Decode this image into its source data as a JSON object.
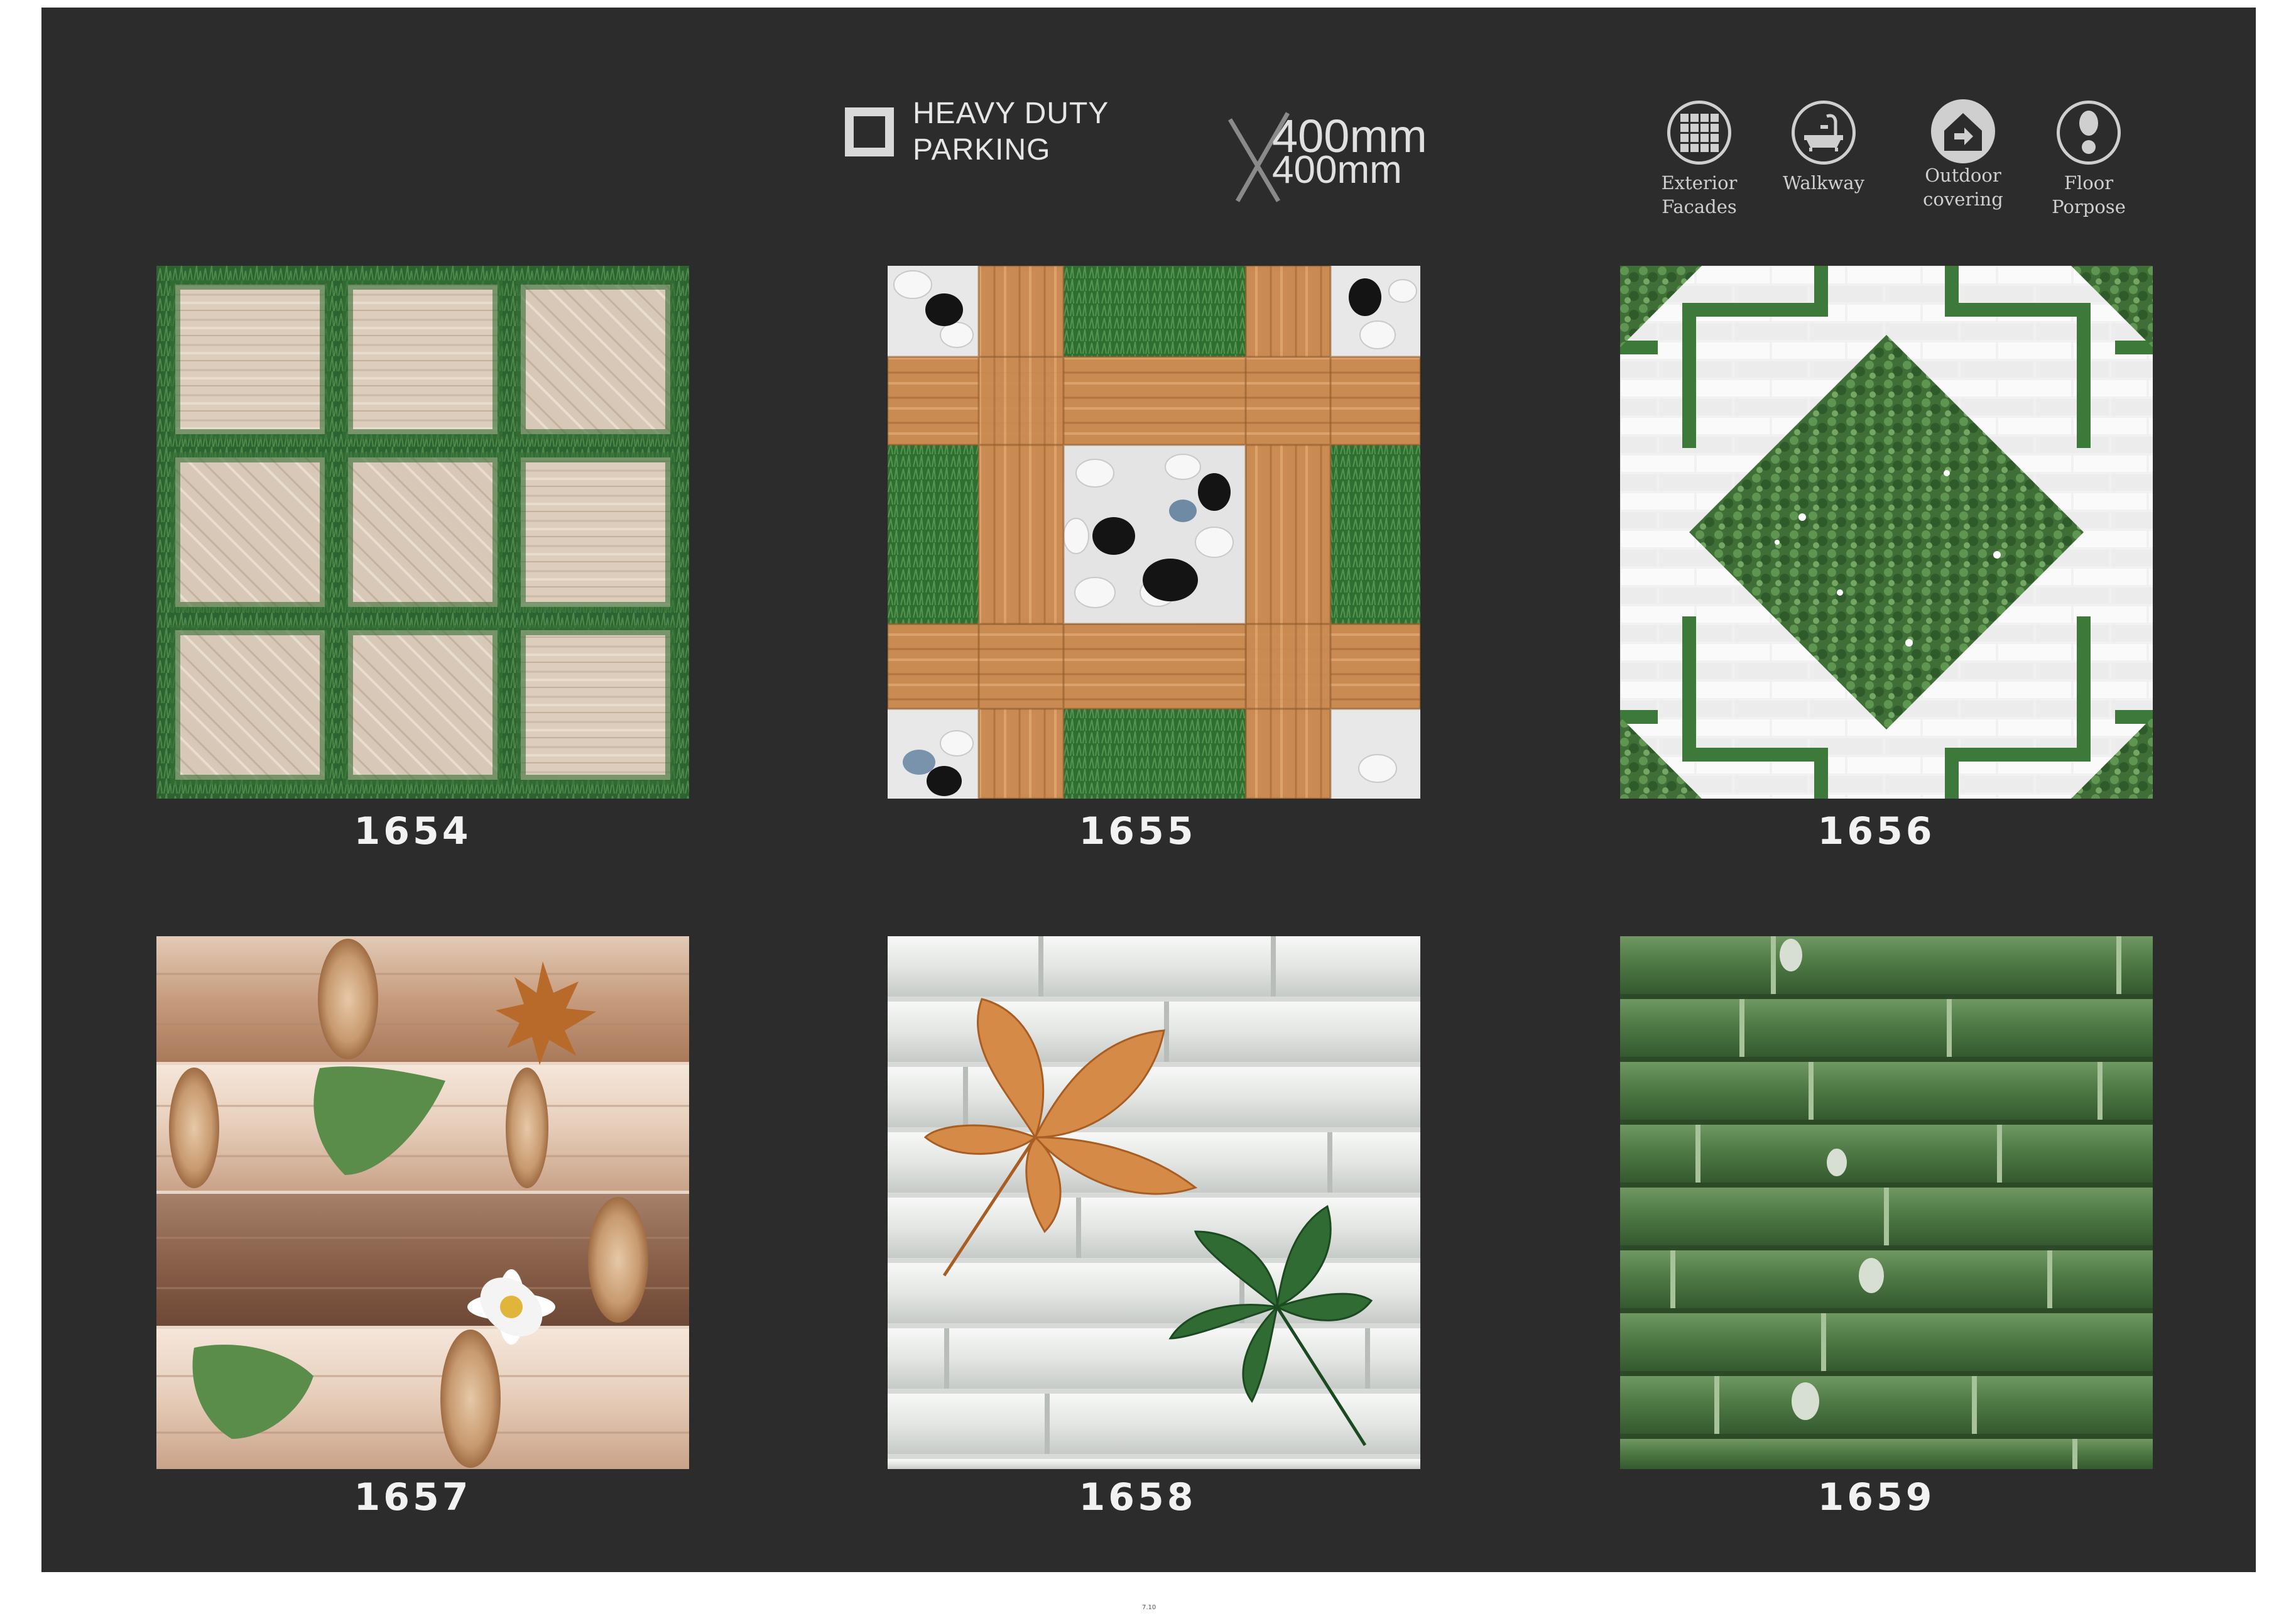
{
  "header": {
    "rating_line1": "HEAVY DUTY",
    "rating_line2": "PARKING",
    "size_line1": "400mm",
    "size_line2": "400mm"
  },
  "usage": [
    {
      "icon": "tile-grid-icon",
      "line1": "Exterior",
      "line2": "Facades"
    },
    {
      "icon": "bathtub-icon",
      "line1": "Walkway",
      "line2": ""
    },
    {
      "icon": "house-arrow-icon",
      "line1": "Outdoor",
      "line2": "covering"
    },
    {
      "icon": "footprint-icon",
      "line1": "Floor",
      "line2": "Porpose"
    }
  ],
  "tiles": [
    {
      "code": "1654"
    },
    {
      "code": "1655"
    },
    {
      "code": "1656"
    },
    {
      "code": "1657"
    },
    {
      "code": "1658"
    },
    {
      "code": "1659"
    }
  ],
  "footer": {
    "page_number": "7.10"
  },
  "colors": {
    "panel": "#2d2c2d",
    "grass": "#2f6b32",
    "wood_light": "#d9c8b6",
    "wood_orange": "#c98a4e",
    "bamboo_green": "#4f7a45",
    "bamboo_white": "#e8ebe8"
  }
}
